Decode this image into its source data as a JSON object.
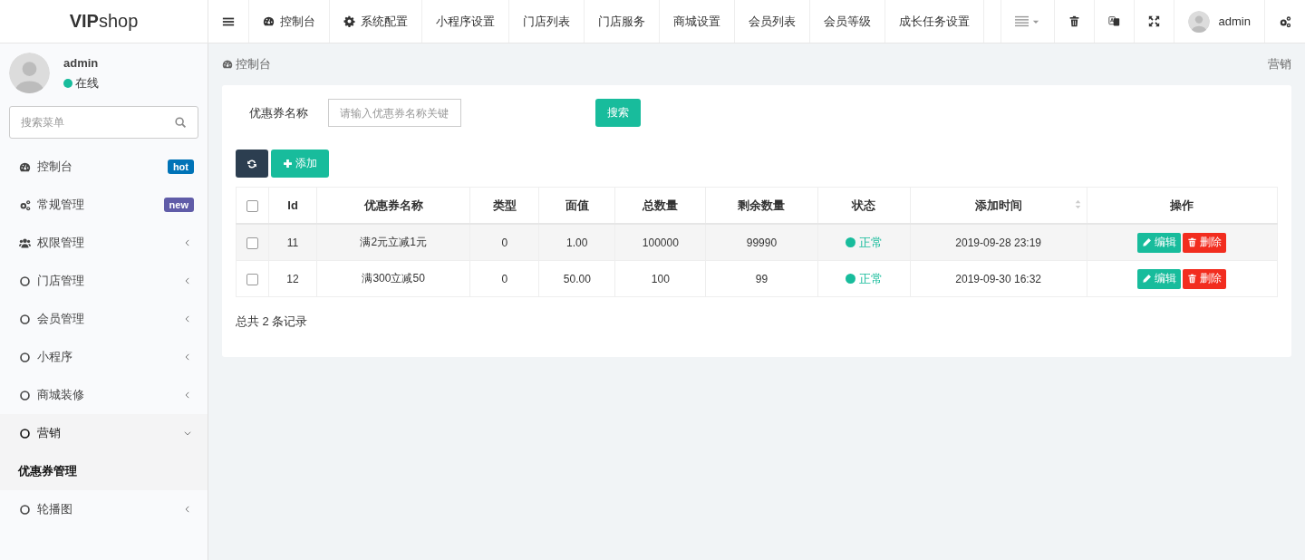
{
  "header": {
    "logo_bold": "VIP",
    "logo_light": "shop",
    "nav": [
      {
        "label": "控制台"
      },
      {
        "label": "系统配置"
      },
      {
        "label": "小程序设置"
      },
      {
        "label": "门店列表"
      },
      {
        "label": "门店服务"
      },
      {
        "label": "商城设置"
      },
      {
        "label": "会员列表"
      },
      {
        "label": "会员等级"
      },
      {
        "label": "成长任务设置"
      }
    ],
    "user": "admin"
  },
  "sidebar": {
    "user": {
      "name": "admin",
      "status": "在线",
      "color": "#18bc9c"
    },
    "search": {
      "placeholder": "搜索菜单"
    },
    "items": [
      {
        "label": "控制台",
        "badge": {
          "text": "hot",
          "color": "#0073b7"
        }
      },
      {
        "label": "常规管理",
        "badge": {
          "text": "new",
          "color": "#605ca8"
        }
      },
      {
        "label": "权限管理",
        "expanded": false
      },
      {
        "label": "门店管理",
        "expanded": false
      },
      {
        "label": "会员管理",
        "expanded": false
      },
      {
        "label": "小程序",
        "expanded": false
      },
      {
        "label": "商城装修",
        "expanded": false
      },
      {
        "label": "营销",
        "expanded": true,
        "children": [
          {
            "label": "优惠券管理",
            "selected": true
          }
        ]
      },
      {
        "label": "轮播图",
        "expanded": false
      }
    ]
  },
  "breadcrumb": {
    "current": "控制台",
    "right": "营销"
  },
  "filter": {
    "label": "优惠券名称",
    "placeholder": "请输入优惠券名称关键",
    "button": "搜索"
  },
  "toolbar": {
    "add": "添加"
  },
  "table": {
    "header_checked": false,
    "columns": [
      {
        "label": "Id",
        "sortable": false
      },
      {
        "label": "优惠券名称",
        "sortable": false
      },
      {
        "label": "类型",
        "sortable": false
      },
      {
        "label": "面值",
        "sortable": false
      },
      {
        "label": "总数量",
        "sortable": false
      },
      {
        "label": "剩余数量",
        "sortable": false
      },
      {
        "label": "状态",
        "sortable": false
      },
      {
        "label": "添加时间",
        "sortable": true
      },
      {
        "label": "操作",
        "sortable": false
      }
    ],
    "rows": [
      {
        "checked": false,
        "cells": [
          "11",
          "满2元立减1元",
          "0",
          "1.00",
          "100000",
          "99990"
        ],
        "status": {
          "text": "正常",
          "color": "#18bc9c"
        },
        "time": "2019-09-28 23:19",
        "actions": [
          "编辑",
          "删除"
        ]
      },
      {
        "checked": false,
        "cells": [
          "12",
          "满300立减50",
          "0",
          "50.00",
          "100",
          "99"
        ],
        "status": {
          "text": "正常",
          "color": "#18bc9c"
        },
        "time": "2019-09-30 16:32",
        "actions": [
          "编辑",
          "删除"
        ]
      }
    ],
    "footer": "总共 2 条记录"
  }
}
